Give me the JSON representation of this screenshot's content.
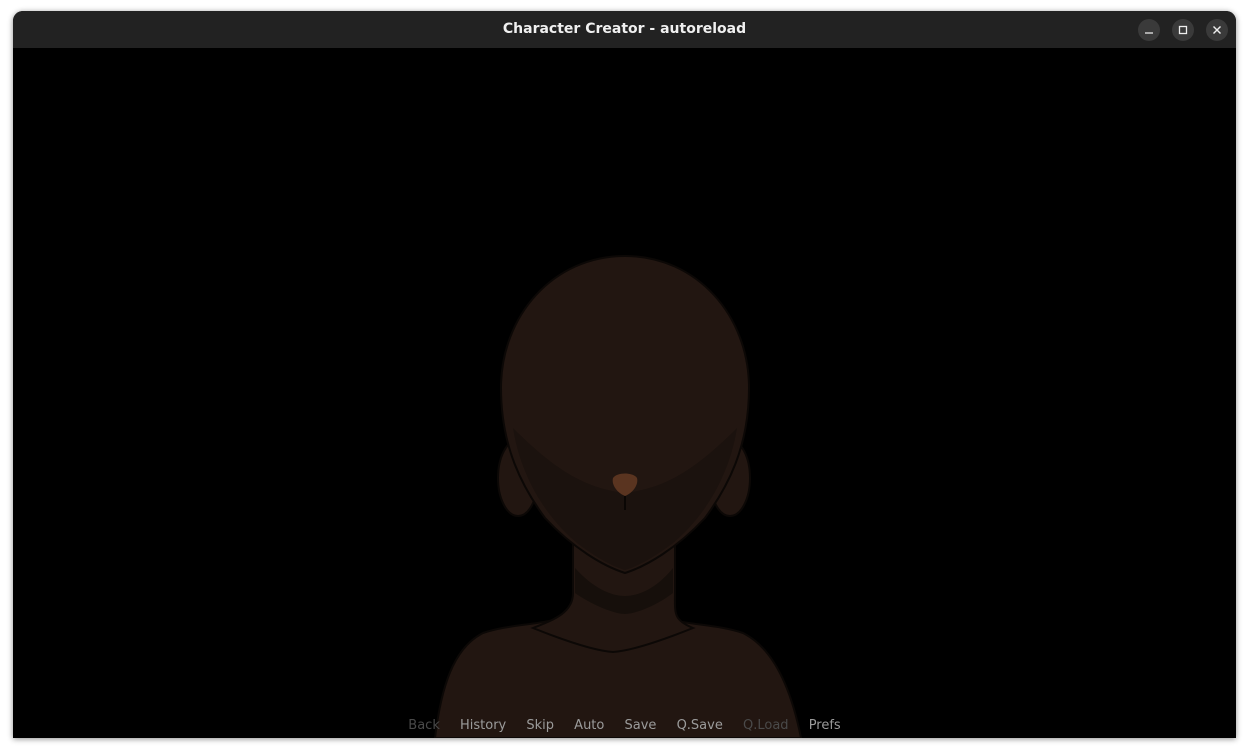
{
  "window": {
    "title": "Character Creator - autoreload",
    "controls": [
      "minimize-icon",
      "maximize-icon",
      "close-icon"
    ]
  },
  "quick_menu": {
    "items": [
      {
        "label": "Back",
        "enabled": false
      },
      {
        "label": "History",
        "enabled": true
      },
      {
        "label": "Skip",
        "enabled": true
      },
      {
        "label": "Auto",
        "enabled": true
      },
      {
        "label": "Save",
        "enabled": true
      },
      {
        "label": "Q.Save",
        "enabled": true
      },
      {
        "label": "Q.Load",
        "enabled": false
      },
      {
        "label": "Prefs",
        "enabled": true
      }
    ]
  },
  "colors": {
    "background": "#000000",
    "titlebar": "#222222",
    "skin": "#221611",
    "nose": "#5a3420",
    "menu_text": "#9b9b9b",
    "menu_text_disabled": "#4a4a4a"
  }
}
